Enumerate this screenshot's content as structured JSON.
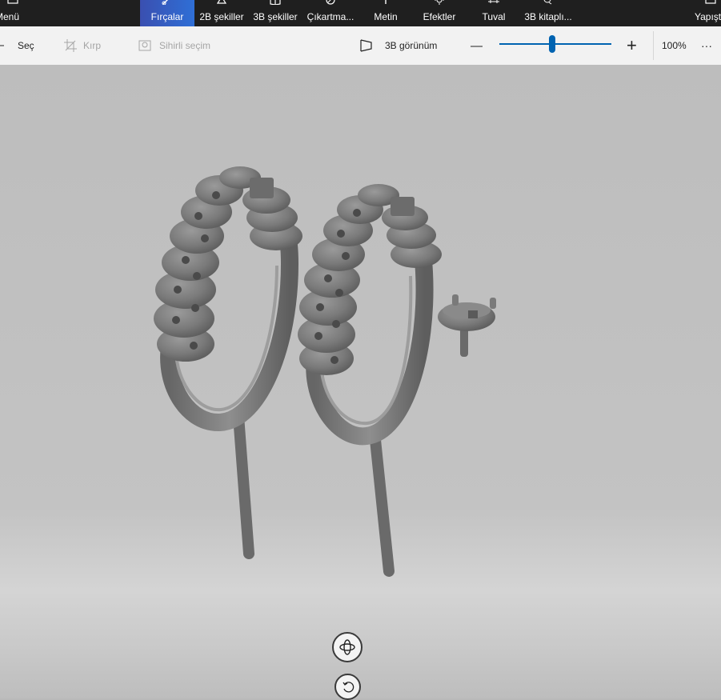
{
  "topbar": {
    "menu_label": "Menü",
    "tabs": [
      {
        "label": "Fırçalar",
        "icon": "brush-icon",
        "active": true
      },
      {
        "label": "2B şekiller",
        "icon": "2d-shapes-icon"
      },
      {
        "label": "3B şekiller",
        "icon": "3d-shapes-icon"
      },
      {
        "label": "Çıkartma...",
        "icon": "sticker-icon"
      },
      {
        "label": "Metin",
        "icon": "text-icon"
      },
      {
        "label": "Efektler",
        "icon": "effects-icon"
      },
      {
        "label": "Tuval",
        "icon": "canvas-icon"
      },
      {
        "label": "3B kitaplı...",
        "icon": "3d-library-icon"
      }
    ],
    "paste_label": "Yapıştı",
    "active_color": "#2f6fd6"
  },
  "toolbar": {
    "select_label": "Seç",
    "crop_label": "Kırp",
    "magic_select_label": "Sihirli seçim",
    "view3d_label": "3B görünüm",
    "zoom_minus": "—",
    "zoom_plus": "+",
    "zoom_value": "100%",
    "zoom_slider_level": 0.47,
    "more_label": "···"
  },
  "canvas": {
    "background_color": "#bdbdbd",
    "objects": [
      "ring-model-left",
      "ring-model-right",
      "stone-setting-head"
    ]
  },
  "bottom_controls": [
    "orbit-view-icon",
    "undo-view-icon"
  ]
}
